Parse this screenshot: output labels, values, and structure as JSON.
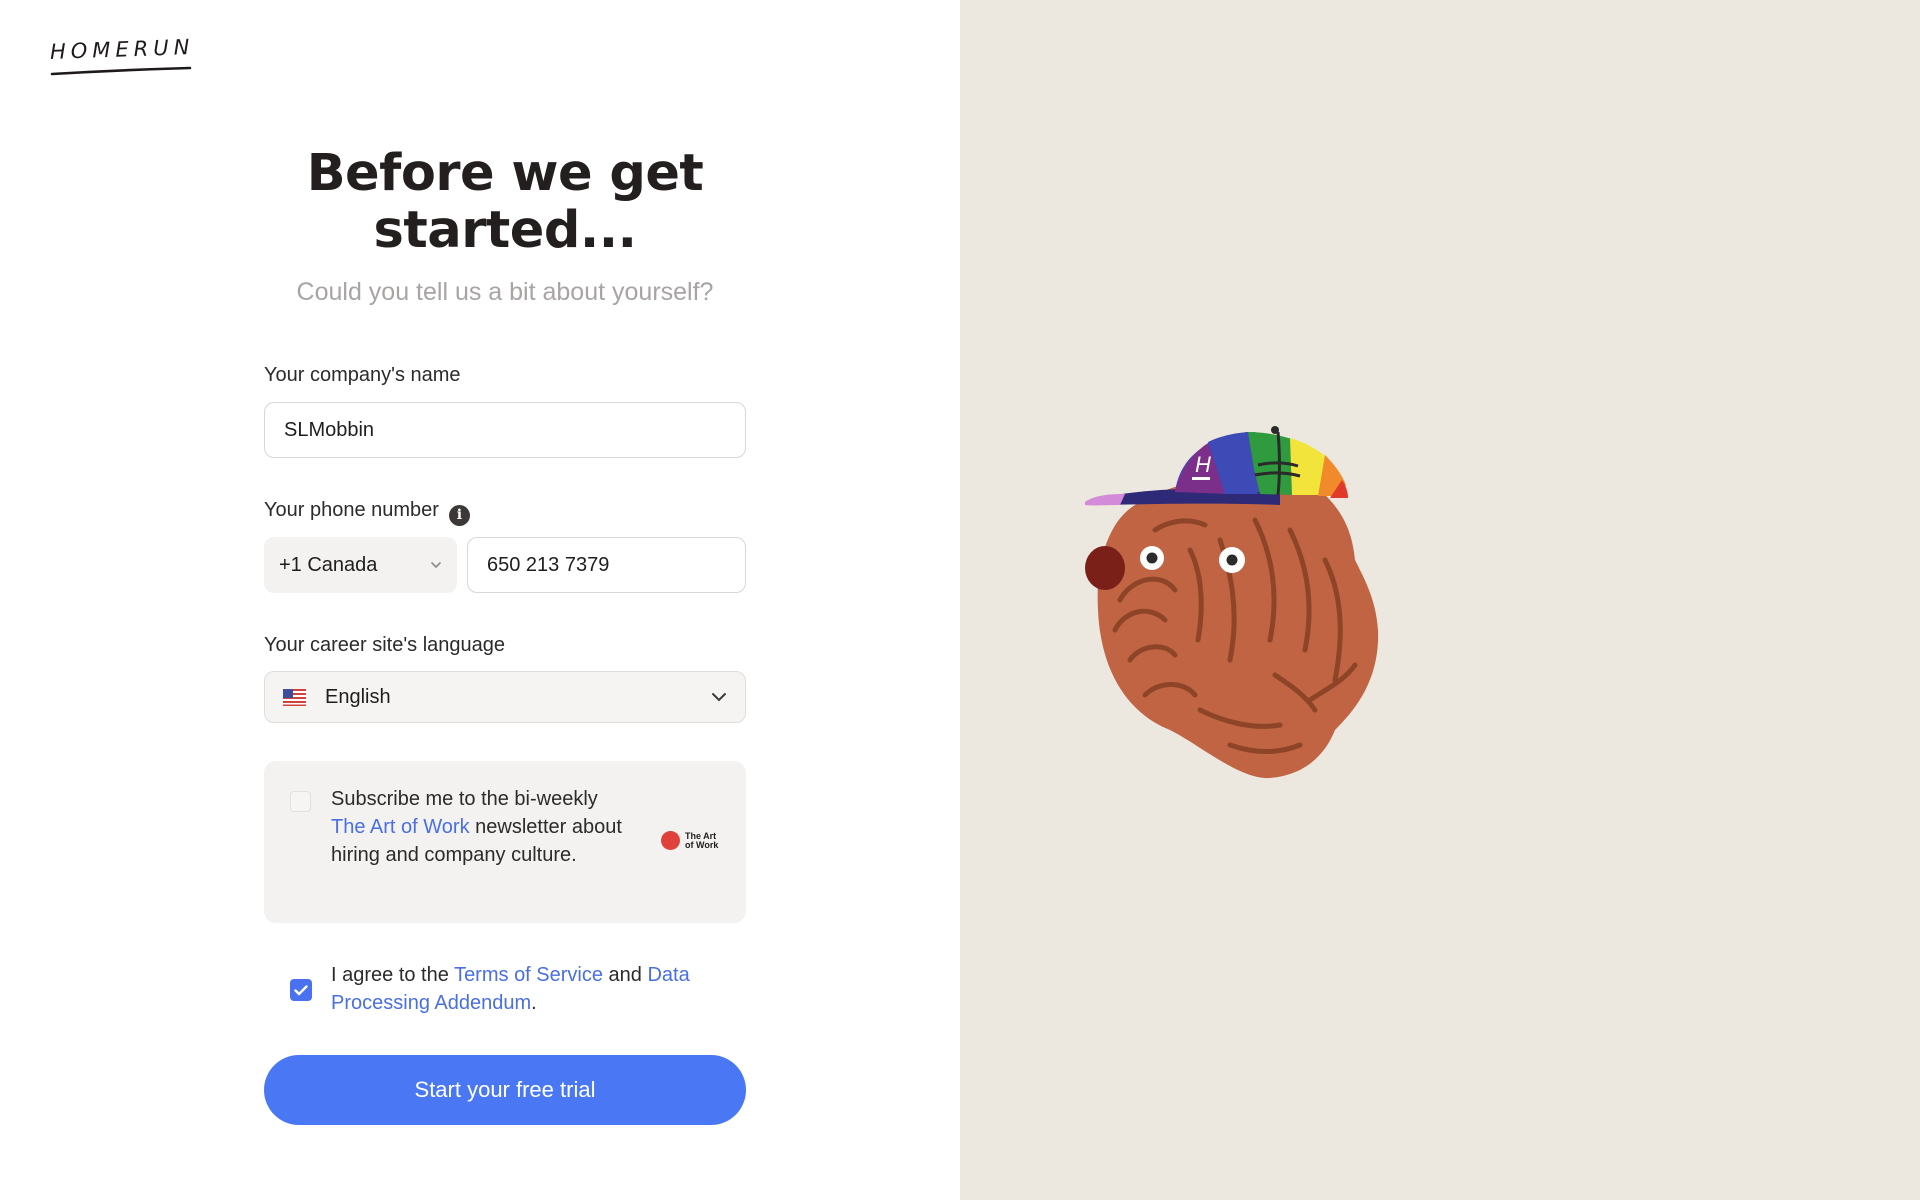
{
  "brand": {
    "logo_text": "HOMERUN"
  },
  "header": {
    "title_line1": "Before we get",
    "title_line2": "started...",
    "subtitle": "Could you tell us a bit about yourself?"
  },
  "form": {
    "company": {
      "label": "Your company's name",
      "value": "SLMobbin"
    },
    "phone": {
      "label": "Your phone number",
      "country_code": "+1 Canada",
      "value": "650 213 7379"
    },
    "language": {
      "label": "Your career site's language",
      "value": "English",
      "flag": "us-flag-icon"
    },
    "newsletter": {
      "checked": false,
      "text_before": "Subscribe me to the bi-weekly ",
      "link": "The Art of Work",
      "text_after": " newsletter about hiring and company culture.",
      "logo_line1": "The Art",
      "logo_line2": "of Work"
    },
    "terms": {
      "checked": true,
      "text_before": "I agree to the ",
      "link_terms": "Terms of Service",
      "text_middle": " and ",
      "link_dpa": "Data Processing Addendum",
      "text_after": "."
    },
    "submit_label": "Start your free trial"
  },
  "colors": {
    "accent": "#4a78f5",
    "link": "#4a6fe0",
    "right_background": "#ede8df",
    "subtitle": "#a8a4a4"
  },
  "illustration": {
    "name": "bulldog-with-rainbow-cap",
    "cap_letter": "H"
  }
}
